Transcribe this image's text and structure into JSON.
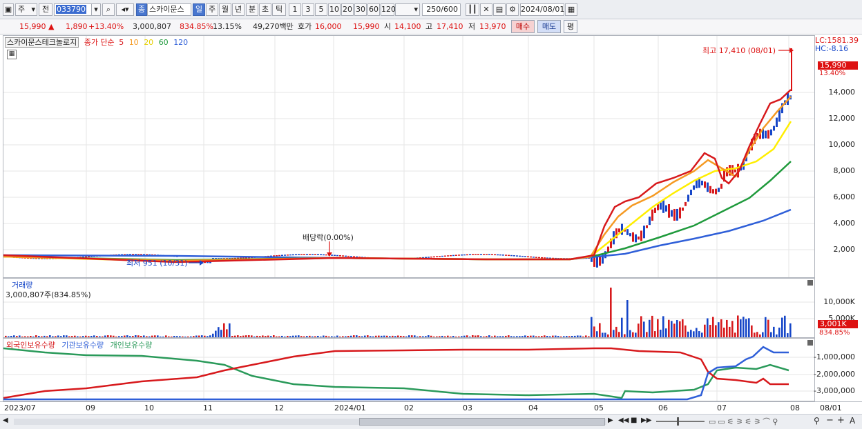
{
  "toolbar": {
    "market": "주",
    "scope": "전",
    "code": "033790",
    "name": "스카이문스",
    "gbadge": "종",
    "periods": [
      "일",
      "주",
      "월",
      "년",
      "분",
      "초",
      "틱"
    ],
    "intervals": [
      "1",
      "3",
      "5",
      "10",
      "20",
      "30",
      "60",
      "120"
    ],
    "count": "250/600",
    "date": "2024/08/01"
  },
  "quote": {
    "price": "15,990 ▲",
    "change": "1,890",
    "change_pct": "+13.40%",
    "volume": "3,000,807",
    "volume_pct": "834.85%",
    "turnover": "13.15%",
    "amount": "49,270백만",
    "ask_label": "호가",
    "ask": "16,000",
    "bid": "15,990",
    "open_label": "시",
    "open": "14,100",
    "high_label": "고",
    "high": "17,410",
    "low_label": "저",
    "low": "13,970",
    "buy_label": "매수",
    "sell_label": "매도",
    "avg_label": "평"
  },
  "price_pane": {
    "legend_name": "스카이문스테크놀로지",
    "legend_ma_title": "종가 단순",
    "ma_periods": [
      "5",
      "10",
      "20",
      "60",
      "120"
    ],
    "ma_colors": {
      "5": "#d7191c",
      "10": "#f59a23",
      "20": "#ffee00",
      "60": "#1f9a3c",
      "120": "#2f5fd8"
    },
    "lc": "LC:1581.39",
    "hc": "HC:-8.16",
    "high_note": "최고 17,410 (08/01)",
    "low_note": "최저 951 (10/31)",
    "dividend_note": "배당락(0.00%)",
    "last_price_tag": "15,990",
    "last_pct_tag": "13.40%",
    "y_ticks": [
      "14,000",
      "12,000",
      "10,000",
      "8,000",
      "6,000",
      "4,000",
      "2,000"
    ]
  },
  "volume_pane": {
    "title": "거래량",
    "value": "3,000,807주(834.85%)",
    "y_ticks": [
      "10,000K",
      "5,000K"
    ],
    "last_tag": "3,001K",
    "pct_tag": "834.85%"
  },
  "holding_pane": {
    "legend": [
      "외국인보유수량",
      "기관보유수량",
      "개인보유수량"
    ],
    "colors": [
      "#d7191c",
      "#2f5fd8",
      "#2a9a5a"
    ],
    "y_ticks": [
      "-1,000,000",
      "-2,000,000",
      "-3,000,000"
    ]
  },
  "x_axis": {
    "labels": [
      "2023/07",
      "09",
      "10",
      "11",
      "12",
      "2024/01",
      "02",
      "03",
      "04",
      "05",
      "06",
      "07",
      "08",
      "08/01"
    ]
  }
}
